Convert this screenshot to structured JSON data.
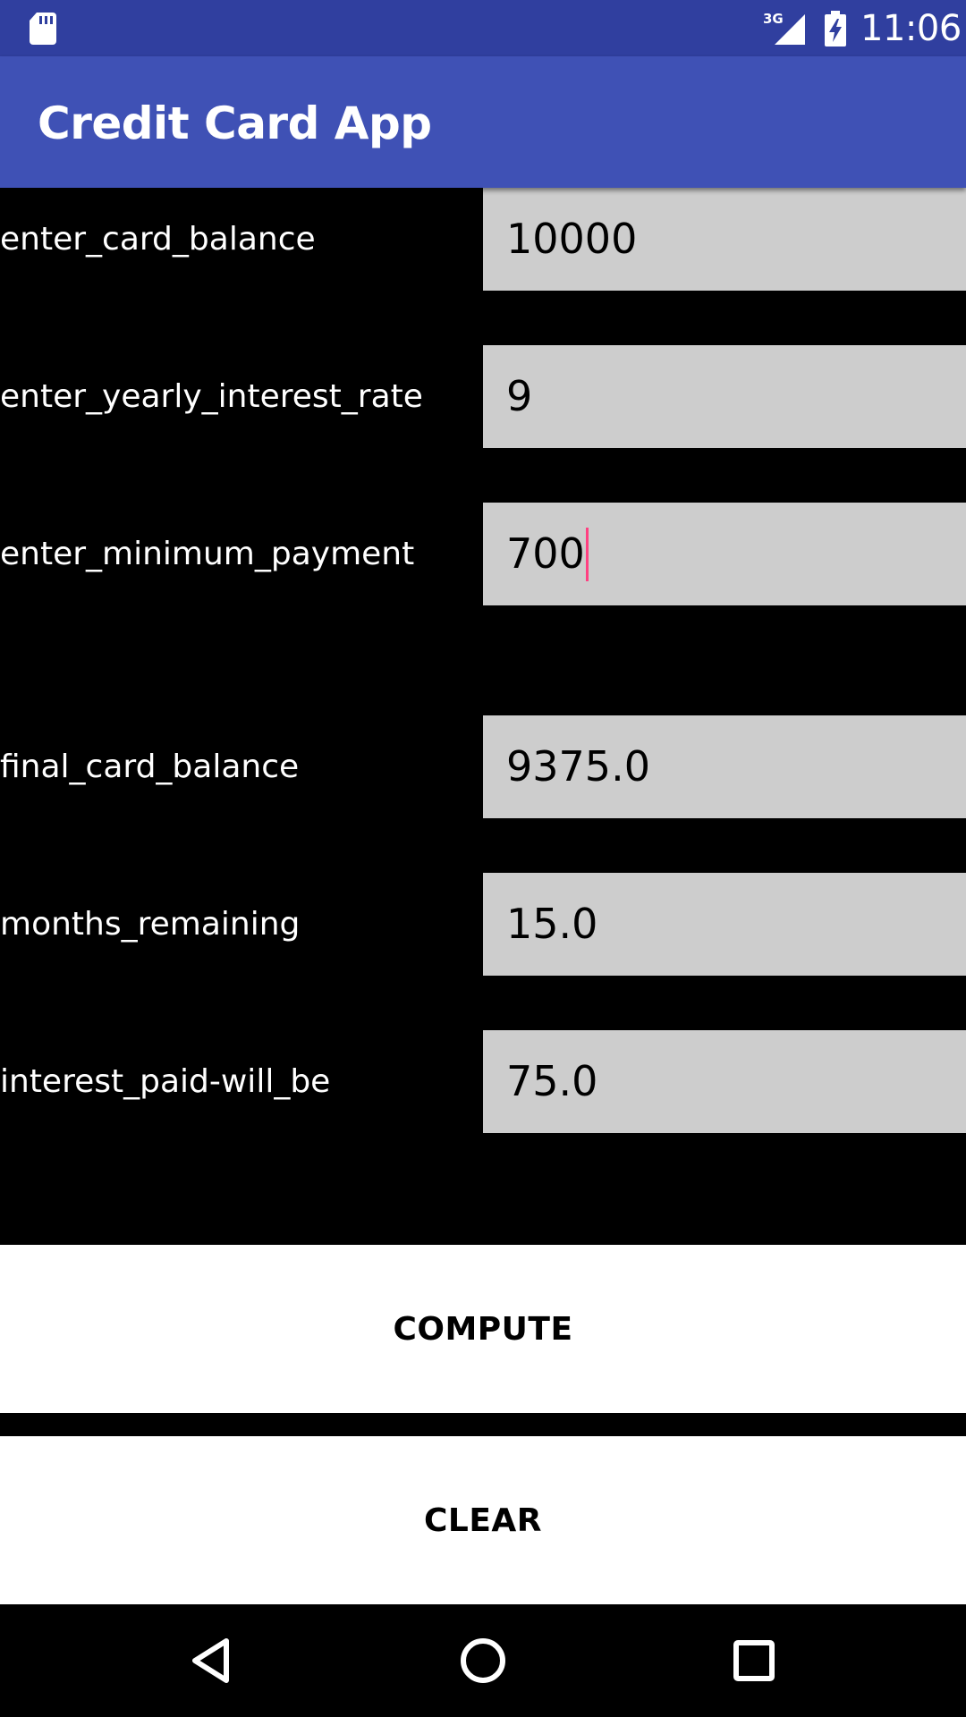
{
  "status_bar": {
    "network_label": "3G",
    "time": "11:06",
    "icons": [
      "sd-card-icon",
      "cell-signal-icon",
      "battery-charging-icon"
    ]
  },
  "app_bar": {
    "title": "Credit Card App"
  },
  "form": {
    "rows": [
      {
        "label": "enter_card_balance",
        "value": "10000"
      },
      {
        "label": "enter_yearly_interest_rate",
        "value": "9"
      },
      {
        "label": "enter_minimum_payment",
        "value": "700"
      },
      {
        "label": "final_card_balance",
        "value": "9375.0"
      },
      {
        "label": "months_remaining",
        "value": "15.0"
      },
      {
        "label": "interest_paid-will_be",
        "value": "75.0"
      }
    ]
  },
  "buttons": {
    "compute": "COMPUTE",
    "clear": "CLEAR"
  },
  "nav_bar": {
    "icons": [
      "back-icon",
      "home-icon",
      "recents-icon"
    ]
  },
  "colors": {
    "status_bar": "#303f9f",
    "primary": "#3f51b5",
    "accent_cursor": "#ff4081",
    "field_background": "#cdcdcd",
    "background": "#000000"
  }
}
